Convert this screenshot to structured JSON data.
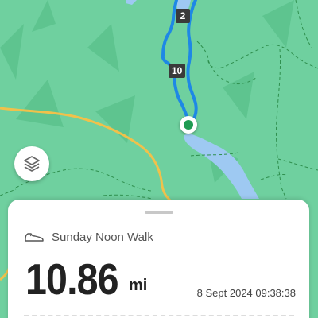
{
  "map": {
    "km_markers": [
      "2",
      "10"
    ],
    "colors": {
      "land": "#6fd09f",
      "water": "#9ec9f2",
      "route": "#1e88e5",
      "road": "#f0c14b",
      "trail": "#2f8f4e",
      "start": "#1f9b52"
    },
    "start_marker_icon": "start-dot-icon",
    "layers_icon": "layers-icon"
  },
  "activity": {
    "icon": "shoe-icon",
    "name": "Sunday Noon Walk",
    "distance": "10.86",
    "unit": "mi",
    "datetime": "8 Sept 2024 09:38:38"
  }
}
